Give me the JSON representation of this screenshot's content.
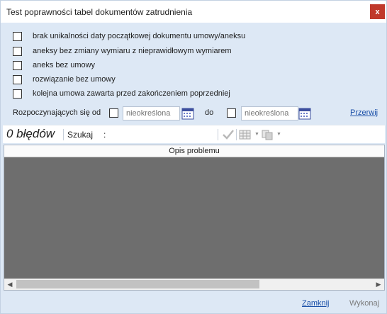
{
  "window": {
    "title": "Test poprawności tabel dokumentów zatrudnienia",
    "close_label": "x"
  },
  "checks": [
    {
      "label": "brak unikalności daty początkowej dokumentu umowy/aneksu",
      "checked": false
    },
    {
      "label": "aneksy bez zmiany wymiaru z nieprawidłowym wymiarem",
      "checked": false
    },
    {
      "label": "aneks bez umowy",
      "checked": false
    },
    {
      "label": "rozwiązanie bez umowy",
      "checked": false
    },
    {
      "label": "kolejna umowa zawarta przed zakończeniem poprzedniej",
      "checked": false
    }
  ],
  "dates": {
    "label": "Rozpoczynających się od",
    "from_placeholder": "nieokreślona",
    "to_label": "do",
    "to_placeholder": "nieokreślona",
    "interrupt_link": "Przerwij"
  },
  "toolbar": {
    "error_count": "0 błędów",
    "search_label": "Szukaj",
    "search_colon": ":",
    "search_value": ""
  },
  "grid": {
    "column_header": "Opis problemu",
    "rows": []
  },
  "footer": {
    "close_link": "Zamknij",
    "execute_label": "Wykonaj"
  },
  "colors": {
    "accent": "#1a4fa8",
    "close": "#c0392b",
    "background": "#dde8f5",
    "grid_bg": "#6e6e6e"
  }
}
